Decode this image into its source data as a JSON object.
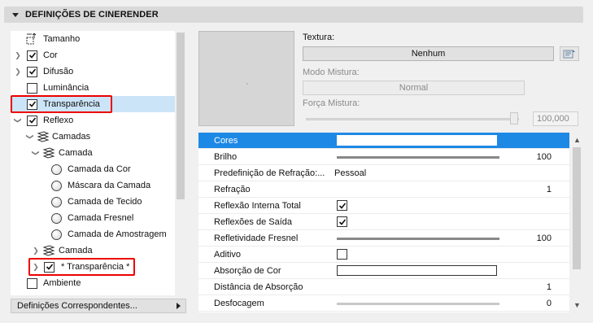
{
  "title": "DEFINIÇÕES DE CINERENDER",
  "tree": {
    "items": [
      {
        "label": "Tamanho",
        "checked": false,
        "icon": "size-icon"
      },
      {
        "label": "Cor",
        "checked": true,
        "expandable": true
      },
      {
        "label": "Difusão",
        "checked": true,
        "expandable": true
      },
      {
        "label": "Luminância",
        "checked": false
      },
      {
        "label": "Transparência",
        "checked": true,
        "selected": true
      },
      {
        "label": "Reflexo",
        "checked": true,
        "expanded": true
      },
      {
        "label": "Camadas",
        "icon": "layers-icon"
      },
      {
        "label": "Camada",
        "icon": "layers-icon"
      },
      {
        "label": "Camada da Cor",
        "icon": "radio"
      },
      {
        "label": "Máscara da Camada",
        "icon": "radio"
      },
      {
        "label": "Camada de Tecido",
        "icon": "radio"
      },
      {
        "label": "Camada Fresnel",
        "icon": "radio"
      },
      {
        "label": "Camada de Amostragem",
        "icon": "radio"
      },
      {
        "label": "Camada",
        "icon": "layers-icon",
        "expandable": true
      },
      {
        "label": "* Transparência *",
        "checked": true,
        "expandable": true
      },
      {
        "label": "Ambiente",
        "checked": false
      }
    ]
  },
  "match_button": "Definições Correspondentes...",
  "texture": {
    "label": "Textura:",
    "value": "Nenhum",
    "mix_mode_label": "Modo Mistura:",
    "mix_mode_value": "Normal",
    "mix_strength_label": "Força Mistura:",
    "mix_strength_value": "100,000"
  },
  "properties": [
    {
      "name": "Cores",
      "type": "color",
      "selected": true
    },
    {
      "name": "Brilho",
      "type": "slider",
      "value": "100",
      "level": 1.0
    },
    {
      "name": "Predefinição de Refração:...",
      "type": "text",
      "value": "Pessoal"
    },
    {
      "name": "Refração",
      "type": "number",
      "value": "1"
    },
    {
      "name": "Reflexão Interna Total",
      "type": "checkbox",
      "checked": true
    },
    {
      "name": "Reflexões de Saída",
      "type": "checkbox",
      "checked": true
    },
    {
      "name": "Refletividade Fresnel",
      "type": "slider",
      "value": "100",
      "level": 1.0
    },
    {
      "name": "Aditivo",
      "type": "checkbox",
      "checked": false
    },
    {
      "name": "Absorção de Cor",
      "type": "color"
    },
    {
      "name": "Distância de Absorção",
      "type": "number",
      "value": "1"
    },
    {
      "name": "Desfocagem",
      "type": "slider",
      "value": "0",
      "level": 0.0
    }
  ],
  "colors": {
    "accent": "#1e88e5",
    "highlight_box": "#e00000",
    "selection": "#cce4f7"
  }
}
